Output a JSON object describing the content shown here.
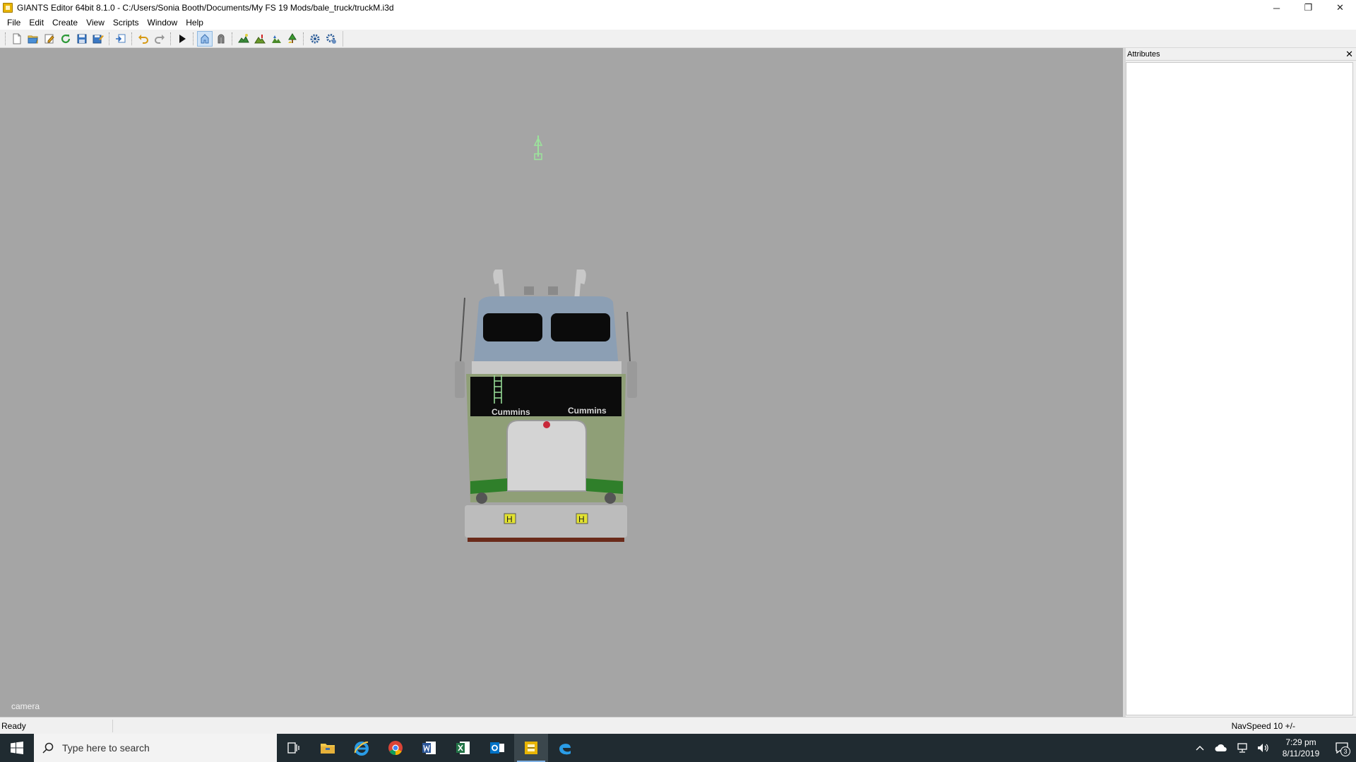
{
  "window": {
    "title": "GIANTS Editor 64bit 8.1.0 - C:/Users/Sonia Booth/Documents/My FS 19 Mods/bale_truck/truckM.i3d",
    "minimize_glyph": "─",
    "restore_glyph": "❐",
    "close_glyph": "✕"
  },
  "menu": [
    "File",
    "Edit",
    "Create",
    "View",
    "Scripts",
    "Window",
    "Help"
  ],
  "toolbar": {
    "icons": [
      "new-file-icon",
      "open-folder-icon",
      "edit-icon",
      "refresh-icon",
      "save-icon",
      "save-as-icon",
      "import-icon",
      "undo-icon",
      "redo-icon",
      "play-icon",
      "select-icon",
      "magnet-icon",
      "terrain-paint-icon",
      "terrain-height-icon",
      "foliage-icon",
      "tree-icon",
      "settings-gear-icon",
      "advanced-settings-icon"
    ],
    "active": "select-icon"
  },
  "viewport": {
    "camera_label": "camera",
    "background_color": "#a5a5a5",
    "truck_brand_text": "Cummins",
    "hazard_plate_text": "H"
  },
  "attributes": {
    "title": "Attributes",
    "close_glyph": "✕"
  },
  "status": {
    "text": "Ready",
    "navspeed": "NavSpeed 10 +/-"
  },
  "taskbar": {
    "search_placeholder": "Type here to search",
    "apps": [
      "task-view-icon",
      "file-explorer-icon",
      "internet-explorer-icon",
      "chrome-icon",
      "word-icon",
      "excel-icon",
      "outlook-icon",
      "giants-editor-icon",
      "edge-icon"
    ],
    "time": "7:29 pm",
    "date": "8/11/2019",
    "notification_count": "3"
  }
}
